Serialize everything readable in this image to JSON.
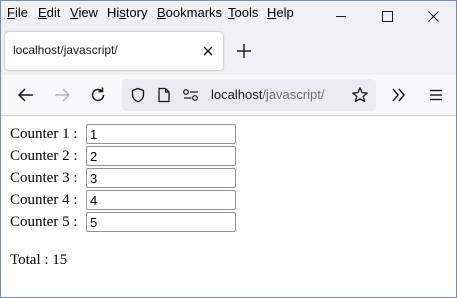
{
  "menu": {
    "items": [
      {
        "u": "F",
        "rest": "ile"
      },
      {
        "u": "E",
        "rest": "dit"
      },
      {
        "u": "V",
        "rest": "iew"
      },
      {
        "pre": "Hi",
        "u": "s",
        "rest": "tory"
      },
      {
        "u": "B",
        "rest": "ookmarks"
      },
      {
        "u": "T",
        "rest": "ools"
      },
      {
        "u": "H",
        "rest": "elp"
      }
    ]
  },
  "tab": {
    "title": "localhost/javascript/"
  },
  "urlbar": {
    "host": "localhost",
    "path": "/javascript/"
  },
  "counters": [
    {
      "label": "Counter 1 :",
      "value": "1"
    },
    {
      "label": "Counter 2 :",
      "value": "2"
    },
    {
      "label": "Counter 3 :",
      "value": "3"
    },
    {
      "label": "Counter 4 :",
      "value": "4"
    },
    {
      "label": "Counter 5 :",
      "value": "5"
    }
  ],
  "total": {
    "text": "Total : 15"
  }
}
